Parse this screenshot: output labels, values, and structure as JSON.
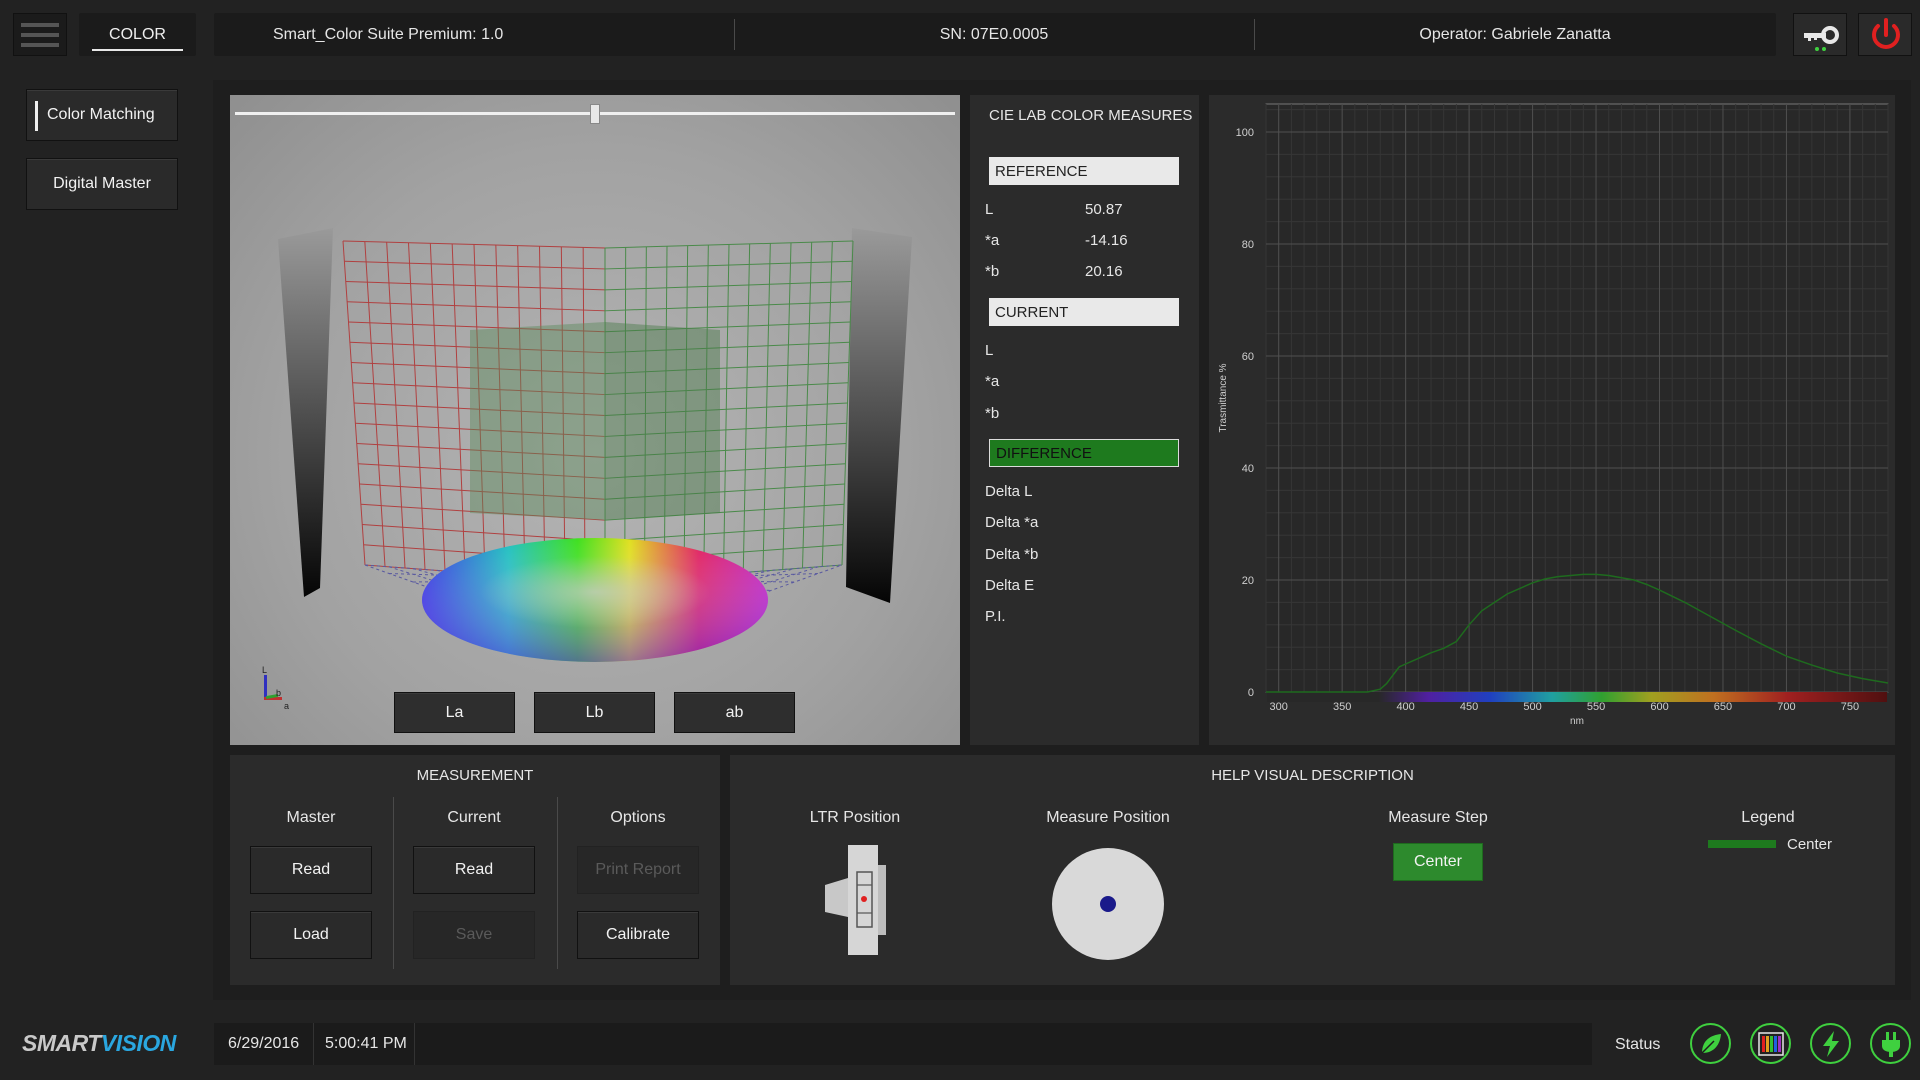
{
  "app": {
    "tab_label": "COLOR",
    "suite_title": "Smart_Color Suite Premium: 1.0",
    "serial": "SN: 07E0.0005",
    "operator": "Operator: Gabriele Zanatta"
  },
  "sidebar": {
    "items": [
      {
        "label": "Color Matching"
      },
      {
        "label": "Digital Master"
      }
    ]
  },
  "viewer": {
    "slider_value": 0.5,
    "buttons": [
      "La",
      "Lb",
      "ab"
    ],
    "axis_labels": {
      "l": "L",
      "b": "b",
      "a": "a"
    }
  },
  "measures": {
    "title": "CIE LAB COLOR MEASURES",
    "reference_label": "REFERENCE",
    "reference": [
      {
        "name": "L",
        "value": "50.87"
      },
      {
        "name": "*a",
        "value": "-14.16"
      },
      {
        "name": "*b",
        "value": "20.16"
      }
    ],
    "current_label": "CURRENT",
    "current": [
      {
        "name": "L",
        "value": ""
      },
      {
        "name": "*a",
        "value": ""
      },
      {
        "name": "*b",
        "value": ""
      }
    ],
    "difference_label": "DIFFERENCE",
    "difference": [
      "Delta L",
      "Delta *a",
      "Delta *b",
      "Delta E",
      "P.I."
    ]
  },
  "chart_data": {
    "type": "line",
    "title": "",
    "xlabel": "nm",
    "ylabel": "Trasmittance %",
    "xlim": [
      290,
      780
    ],
    "ylim": [
      0,
      105
    ],
    "x_ticks": [
      300,
      350,
      400,
      450,
      500,
      550,
      600,
      650,
      700,
      750
    ],
    "y_ticks": [
      0,
      20,
      40,
      60,
      80,
      100
    ],
    "grid": true,
    "series": [
      {
        "name": "Center",
        "color": "#1e6b1e",
        "x": [
          290,
          370,
          380,
          385,
          390,
          395,
          400,
          410,
          420,
          430,
          440,
          450,
          460,
          470,
          480,
          490,
          500,
          510,
          520,
          530,
          540,
          550,
          560,
          570,
          580,
          590,
          600,
          620,
          640,
          660,
          680,
          700,
          720,
          740,
          760,
          780
        ],
        "y": [
          0,
          0,
          0.5,
          1.5,
          3,
          4.5,
          5,
          6,
          7,
          7.8,
          9,
          12,
          14.5,
          16,
          17.5,
          18.5,
          19.5,
          20.2,
          20.6,
          20.8,
          21,
          21,
          20.8,
          20.4,
          20,
          19.2,
          18.2,
          16,
          13.5,
          11,
          8.6,
          6.4,
          4.8,
          3.4,
          2.4,
          1.6
        ]
      }
    ]
  },
  "measurement": {
    "title": "MEASUREMENT",
    "master": {
      "header": "Master",
      "read": "Read",
      "load": "Load"
    },
    "current": {
      "header": "Current",
      "read": "Read",
      "save": "Save"
    },
    "options": {
      "header": "Options",
      "print": "Print Report",
      "calibrate": "Calibrate"
    }
  },
  "help": {
    "title": "HELP VISUAL DESCRIPTION",
    "ltr_position": "LTR Position",
    "measure_position": "Measure Position",
    "measure_step": "Measure Step",
    "step_value": "Center",
    "legend": "Legend",
    "legend_item": "Center",
    "legend_color": "#1e7a1e"
  },
  "footer": {
    "logo_smart": "SMART",
    "logo_vision": "VISION",
    "date": "6/29/2016",
    "time": "5:00:41 PM",
    "status_label": "Status",
    "status_icons": [
      "leaf-icon",
      "color-bars-icon",
      "lightning-icon",
      "plug-icon"
    ]
  },
  "colors": {
    "accent_green": "#2d8a2d",
    "status_green": "#3fd03f",
    "power_red": "#e02020",
    "logo_blue": "#2aa7e0"
  }
}
